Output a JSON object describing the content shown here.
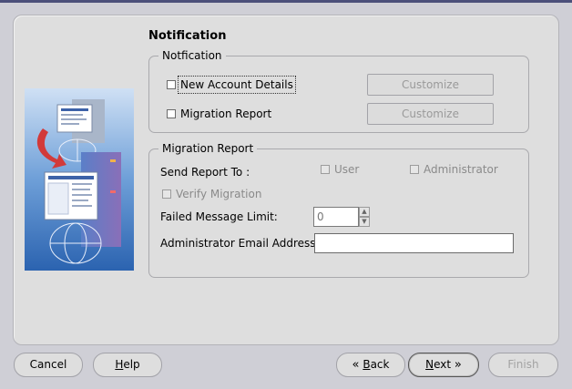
{
  "page": {
    "title": "Notification"
  },
  "notification_group": {
    "legend": "Notfication",
    "new_account_details": {
      "label": "New Account Details",
      "checked": false
    },
    "migration_report": {
      "label": "Migration Report",
      "checked": false
    },
    "customize_label": "Customize"
  },
  "migration_group": {
    "legend": "Migration Report",
    "send_report_to_label": "Send Report To :",
    "user_label": "User",
    "administrator_label": "Administrator",
    "verify_migration_label": "Verify Migration",
    "failed_message_limit_label": "Failed Message Limit:",
    "failed_message_limit_value": "0",
    "admin_email_label": "Administrator Email Address:",
    "admin_email_value": ""
  },
  "footer": {
    "cancel": "Cancel",
    "help": "Help",
    "back": "Back",
    "next": "Next",
    "finish": "Finish"
  },
  "icons": {
    "back_arrow": "«",
    "next_arrow": "»",
    "spin_up": "▲",
    "spin_down": "▼"
  },
  "colors": {
    "window_bg": "#cfcfd6",
    "panel_bg": "#dedede",
    "title_bar_edge": "#4b4f7a",
    "illustration_blue": "#2e6fb8"
  }
}
